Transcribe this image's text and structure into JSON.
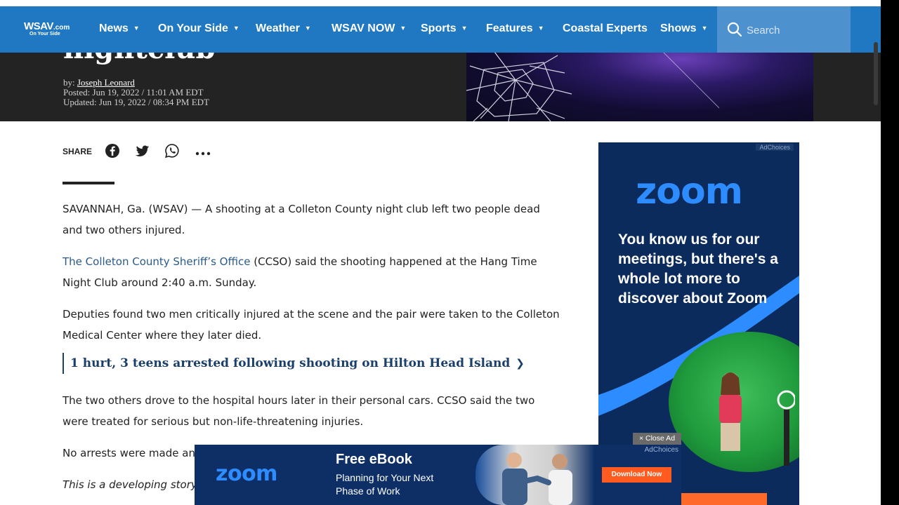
{
  "site": {
    "logo_main": "WSAV",
    "logo_suffix": ".com",
    "logo_tagline": "On Your Side"
  },
  "nav": {
    "items": [
      {
        "label": "News",
        "has_menu": true
      },
      {
        "label": "On Your Side",
        "has_menu": true
      },
      {
        "label": "Weather",
        "has_menu": true
      },
      {
        "label": "WSAV NOW",
        "has_menu": true
      },
      {
        "label": "Sports",
        "has_menu": true
      },
      {
        "label": "Features",
        "has_menu": true
      },
      {
        "label": "Coastal Experts",
        "has_menu": false
      },
      {
        "label": "Shows",
        "has_menu": true
      }
    ],
    "search_placeholder": "Search"
  },
  "article": {
    "title_fragment": "nightclub",
    "byline_prefix": "by:",
    "author": "Joseph Leonard",
    "posted": "Posted: Jun 19, 2022 / 11:01 AM EDT",
    "updated": "Updated: Jun 19, 2022 / 08:34 PM EDT",
    "share_label": "SHARE",
    "paragraphs": {
      "p1": "SAVANNAH, Ga. (WSAV) — A shooting at a Colleton County night club left two people dead and two others injured.",
      "p2_link": "The Colleton County Sheriff’s Office",
      "p2_rest": " (CCSO) said the shooting happened at the Hang Time Night Club around 2:40 a.m. Sunday.",
      "p3": "Deputies found two men critically injured at the scene and the pair were taken to the Colleton Medical Center where they later died.",
      "p4": "The two others drove to the hospital hours later in their personal cars. CCSO said the two were treated for serious but non-life-threatening injuries.",
      "p5": "No arrests were made and",
      "p6": "This is a developing story a"
    },
    "related_link": "1 hurt, 3 teens arrested following shooting on Hilton Head Island"
  },
  "side_ad": {
    "adchoices": "AdChoices",
    "brand": "zoom",
    "headline": "You know us for our meetings, but there's a whole lot more to discover about Zoom"
  },
  "bottom_ad": {
    "close_label": "× Close Ad",
    "adchoices": "AdChoices",
    "brand": "zoom",
    "title": "Free eBook",
    "subtitle": "Planning for Your Next Phase of Work",
    "button": "Download Now"
  },
  "colors": {
    "nav_bg": "#1f78c1",
    "link": "#2a5a8c",
    "related": "#1a3f6b",
    "zoom_blue": "#2d8cff",
    "ad_cta": "#ff5a1f"
  }
}
